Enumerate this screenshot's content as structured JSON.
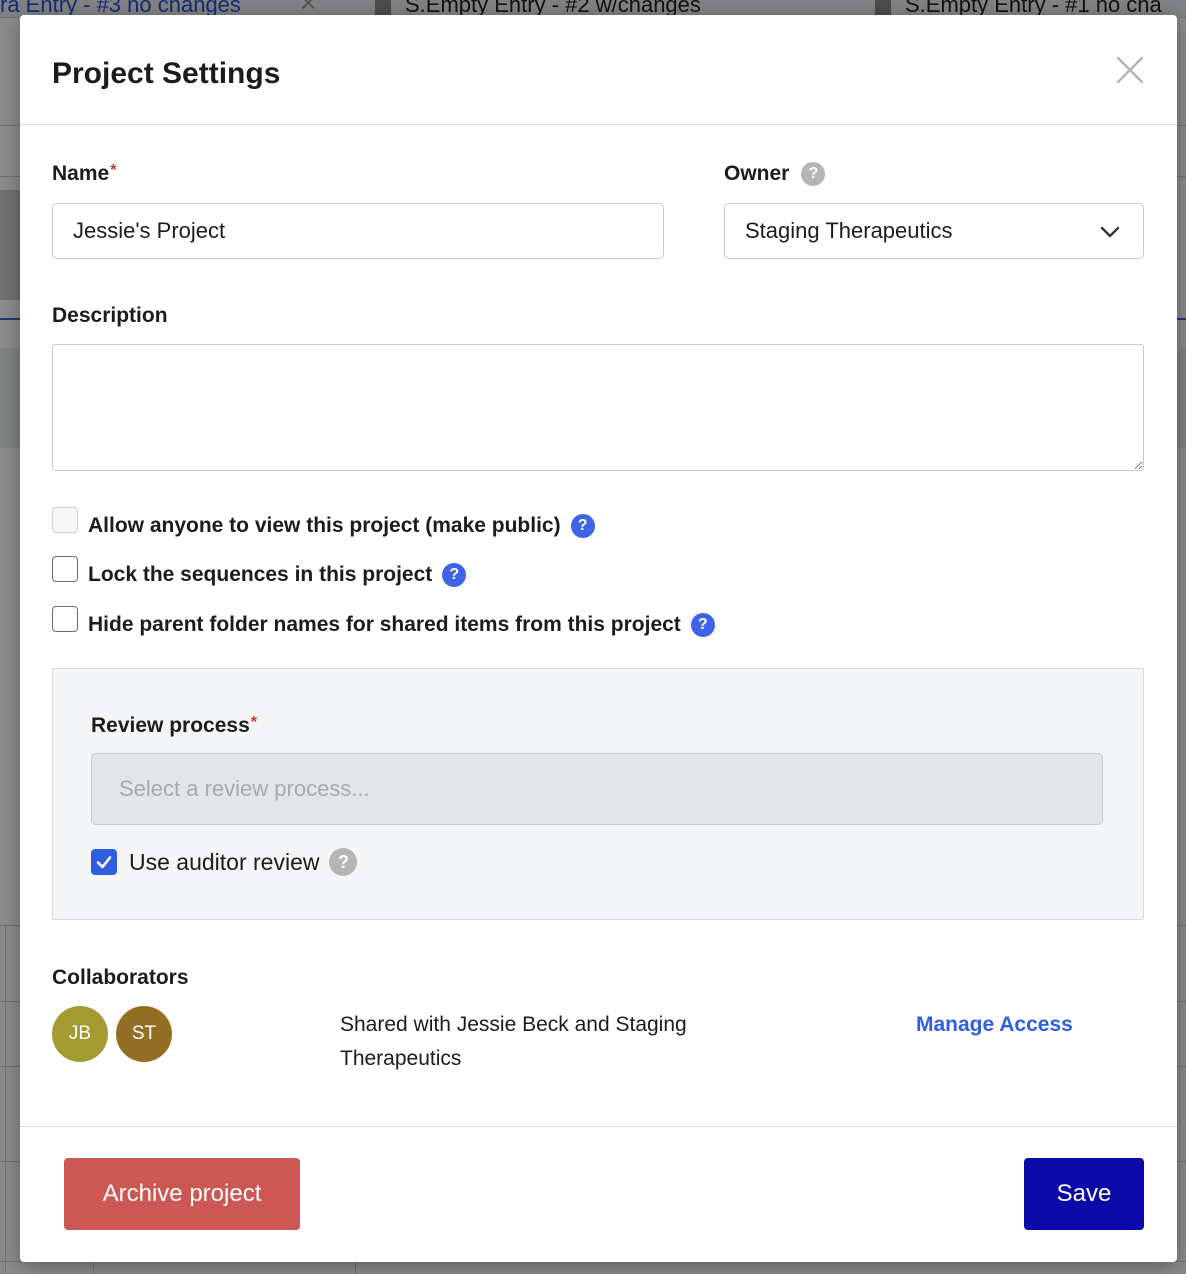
{
  "background": {
    "tabs": [
      {
        "label": "ra Entry - #3 no changes"
      },
      {
        "label": "S.Empty Entry - #2 w/changes"
      },
      {
        "label": "S.Empty Entry - #1 no cha"
      }
    ]
  },
  "modal": {
    "title": "Project Settings",
    "name": {
      "label": "Name",
      "required_mark": "*",
      "value": "Jessie's Project"
    },
    "owner": {
      "label": "Owner",
      "help": "?",
      "value": "Staging Therapeutics"
    },
    "description": {
      "label": "Description",
      "value": ""
    },
    "options": [
      {
        "label": "Allow anyone to view this project (make public)",
        "help": "?",
        "checked": false,
        "disabled": true
      },
      {
        "label": "Lock the sequences in this project",
        "help": "?",
        "checked": false,
        "disabled": false
      },
      {
        "label": "Hide parent folder names for shared items from this project",
        "help": "?",
        "checked": false,
        "disabled": false
      }
    ],
    "review": {
      "label": "Review process",
      "required_mark": "*",
      "placeholder": "Select a review process...",
      "auditor_label": "Use auditor review",
      "auditor_help": "?",
      "auditor_checked": true
    },
    "collaborators": {
      "label": "Collaborators",
      "avatars": [
        {
          "initials": "JB",
          "color": "#a39a32"
        },
        {
          "initials": "ST",
          "color": "#946f23"
        }
      ],
      "shared_text": "Shared with Jessie Beck and Staging Therapeutics",
      "manage_label": "Manage Access"
    },
    "footer": {
      "archive_label": "Archive project",
      "save_label": "Save"
    }
  },
  "colors": {
    "primary": "#0a0aa8",
    "link": "#2f5fe0",
    "danger": "#cd5853",
    "help_blue": "#3f63e8"
  }
}
